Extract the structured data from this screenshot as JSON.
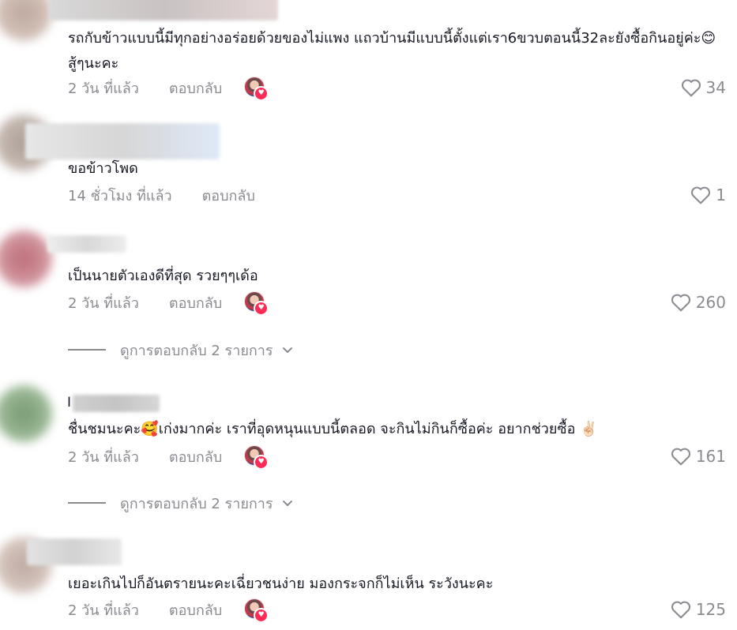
{
  "comments": [
    {
      "text": "รถกับข้าวแบบนี้มีทุกอย่างอร่อยด้วยของไม่แพง แถวบ้านมีแบบนี้ตั้งแต่เรา6ขวบตอนนี้32ละยังซื้อกินอยู่ค่ะ😊  สู้ๆนะคะ",
      "time": "2 วัน ที่แล้ว",
      "reply": "ตอบกลับ",
      "likes": "34",
      "creator_liked": true
    },
    {
      "text": "ขอข้าวโพด",
      "time": "14 ชั่วโมง ที่แล้ว",
      "reply": "ตอบกลับ",
      "likes": "1",
      "creator_liked": false
    },
    {
      "text": "เป็นนายตัวเองดีที่สุด รวยๆๆเด้อ",
      "time": "2 วัน ที่แล้ว",
      "reply": "ตอบกลับ",
      "likes": "260",
      "creator_liked": true,
      "view_replies": "ดูการตอบกลับ 2 รายการ"
    },
    {
      "username_visible": "I",
      "text": "ชื่นชมนะคะ🥰เก่งมากค่ะ เราที่อุดหนุนแบบนี้ตลอด จะกินไม่กินก็ซื้อค่ะ อยากช่วยซื้อ ✌🏻",
      "time": "2 วัน ที่แล้ว",
      "reply": "ตอบกลับ",
      "likes": "161",
      "creator_liked": true,
      "view_replies": "ดูการตอบกลับ 2 รายการ"
    },
    {
      "text": "เยอะเกินไปก็อันตรายนะคะเฉี่ยวชนง่าย มองกระจกก็ไม่เห็น ระวังนะคะ",
      "time": "2 วัน ที่แล้ว",
      "reply": "ตอบกลับ",
      "likes": "125",
      "creator_liked": true
    }
  ],
  "colors": {
    "text": "#161823",
    "secondary": "#8a8b91",
    "badge": "#fe2c55"
  },
  "icons": {
    "like": "heart-outline-icon",
    "creator_badge": "heart-badge-icon",
    "expand": "chevron-down-icon"
  }
}
